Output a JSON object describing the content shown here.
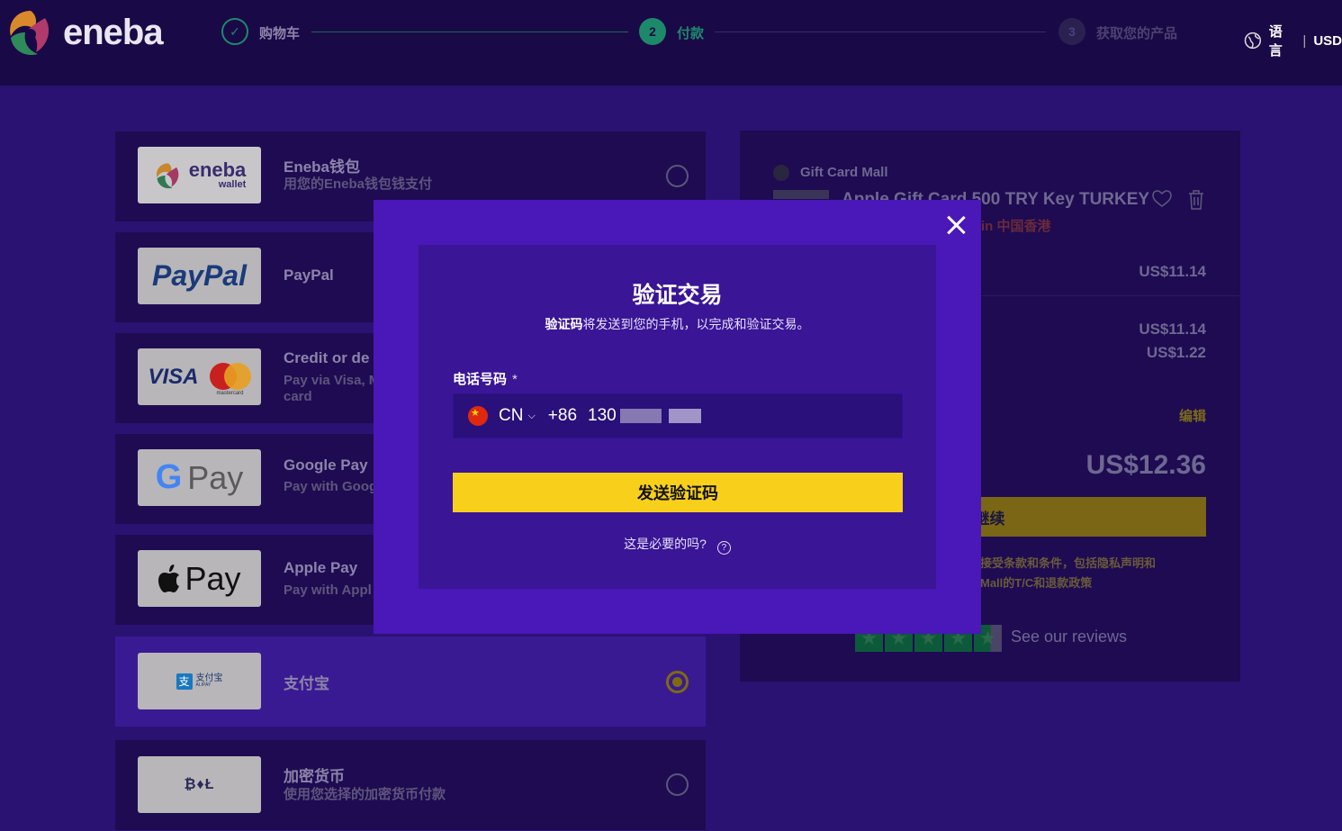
{
  "header": {
    "brand": "eneba",
    "steps": [
      {
        "number": "✓",
        "label": "购物车"
      },
      {
        "number": "2",
        "label": "付款"
      },
      {
        "number": "3",
        "label": "获取您的产品"
      }
    ],
    "language_label": "语言",
    "currency": "USD"
  },
  "payment_methods": [
    {
      "title": "Eneba钱包",
      "subtitle": "用您的Eneba钱包钱支付",
      "logo_text": "eneba",
      "logo_sub": "wallet"
    },
    {
      "title": "PayPal",
      "subtitle": "",
      "logo_text": "PayPal"
    },
    {
      "title": "Credit or de",
      "subtitle": "Pay via Visa, M card",
      "logo_text": "VISA",
      "logo_sub": "mastercard"
    },
    {
      "title": "Google Pay",
      "subtitle": "Pay with Goog",
      "logo_text": "Pay"
    },
    {
      "title": "Apple Pay",
      "subtitle": "Pay with Appl",
      "logo_text": "Pay"
    },
    {
      "title": "支付宝",
      "subtitle": "",
      "logo_text": "支付宝",
      "logo_sub": "ALIPAY"
    },
    {
      "title": "加密货币",
      "subtitle": "使用您选择的加密货币付款",
      "logo_text": "₿♦Ł"
    }
  ],
  "summary": {
    "seller": "Gift Card Mall",
    "product": "Apple Gift Card 500 TRY Key TURKEY",
    "region_note": "in 中国香港",
    "price": "US$11.14",
    "subtotal": "US$11.14",
    "fee": "US$1.22",
    "edit_label": "编辑",
    "total": "US$12.36",
    "continue_label": "继续",
    "terms_line1": "接受条款和条件，包括隐私声明和",
    "terms_line2": "Mall的T/C和退款政策",
    "reviews_label": "See our reviews"
  },
  "modal": {
    "title": "验证交易",
    "desc_bold": "验证码",
    "desc_rest": "将发送到您的手机，以完成和验证交易。",
    "phone_label": "电话号码",
    "required_mark": "*",
    "country_code": "CN",
    "dial_code": "+86",
    "phone_prefix": "130",
    "send_button": "发送验证码",
    "help_text": "这是必要的吗?",
    "help_icon": "?"
  },
  "colors": {
    "accent_yellow": "#f8d01b",
    "modal_bg": "#4a17b8",
    "page_bg": "#2a1273",
    "header_bg": "#1a0947",
    "step_active": "#1c8a6a"
  }
}
